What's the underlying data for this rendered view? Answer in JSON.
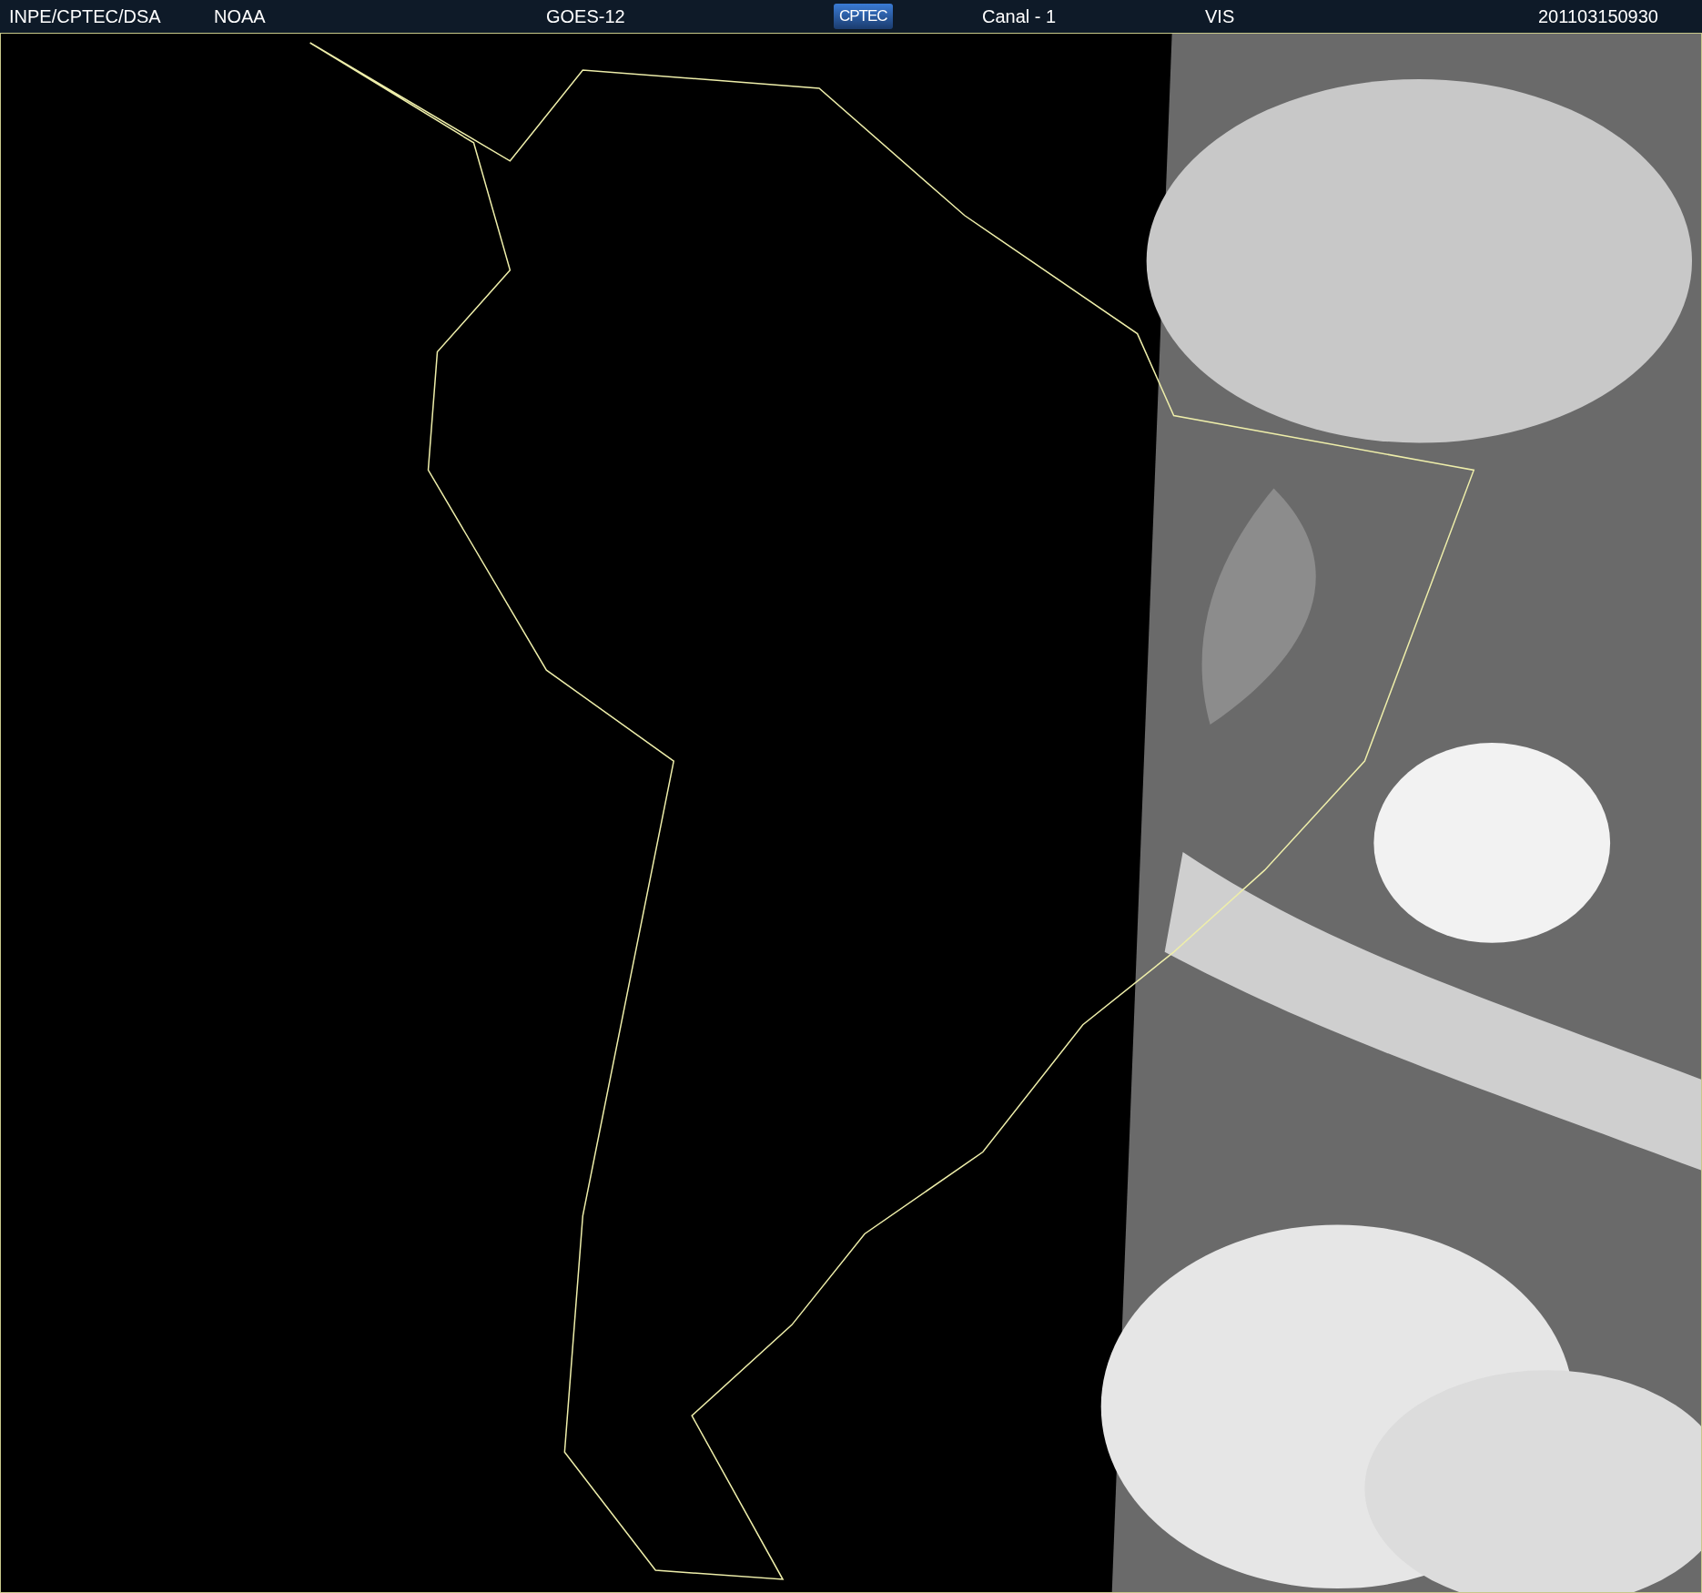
{
  "header": {
    "items": [
      {
        "kind": "text",
        "text": "INPE/CPTEC/DSA"
      },
      {
        "kind": "text",
        "text": "NOAA"
      },
      {
        "kind": "text",
        "text": "GOES-12"
      },
      {
        "kind": "logo",
        "text": "CPTEC"
      },
      {
        "kind": "text",
        "text": "Canal - 1"
      },
      {
        "kind": "text",
        "text": "VIS"
      },
      {
        "kind": "text",
        "text": "201103150930"
      }
    ]
  }
}
